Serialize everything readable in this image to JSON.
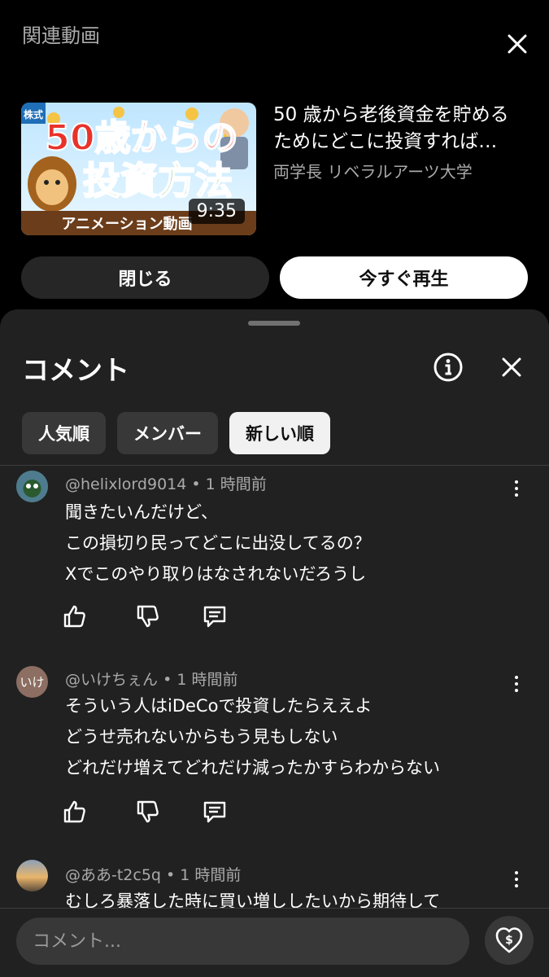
{
  "header": {
    "title": "関連動画"
  },
  "video": {
    "title": "50 歳から老後資金を貯めるためにどこに投資すれば…",
    "channel": "両学長 リベラルアーツ大学",
    "duration": "9:35",
    "thumbnail": {
      "tag": "株式",
      "line1": "50歳からの",
      "line2": "投資方法",
      "banner": "アニメーション動画"
    }
  },
  "buttons": {
    "close_label": "閉じる",
    "play_label": "今すぐ再生"
  },
  "comments_panel": {
    "title": "コメント",
    "chips": [
      {
        "label": "人気順",
        "active": false
      },
      {
        "label": "メンバー",
        "active": false
      },
      {
        "label": "新しい順",
        "active": true
      }
    ]
  },
  "comments": [
    {
      "author": "@helixlord9014",
      "time": "1 時間前",
      "avatar_text": "",
      "lines": [
        "聞きたいんだけど、",
        "この損切り民ってどこに出没してるの？",
        "Xでこのやり取りはなされないだろうし"
      ]
    },
    {
      "author": "@いけちぇん",
      "time": "1 時間前",
      "avatar_text": "いけ",
      "lines": [
        "そういう人はiDeCoで投資したらええよ",
        "どうせ売れないからもう見もしない",
        "どれだけ増えてどれだけ減ったかすらわからない"
      ]
    },
    {
      "author": "@ああ-t2c5q",
      "time": "1 時間前",
      "avatar_text": "",
      "lines": [
        "むしろ暴落した時に買い増ししたいから期待して"
      ]
    }
  ],
  "input": {
    "placeholder": "コメント..."
  },
  "icons": {
    "close": "close-icon",
    "info": "info-icon",
    "like": "thumbs-up-icon",
    "dislike": "thumbs-down-icon",
    "reply": "reply-icon",
    "more": "more-vert-icon",
    "thanks": "heart-dollar-icon"
  },
  "colors": {
    "background": "#000000",
    "sheet": "#212121",
    "chip": "#383838",
    "chip_active": "#f1f1f1",
    "secondary_text": "#aaaaaa"
  }
}
